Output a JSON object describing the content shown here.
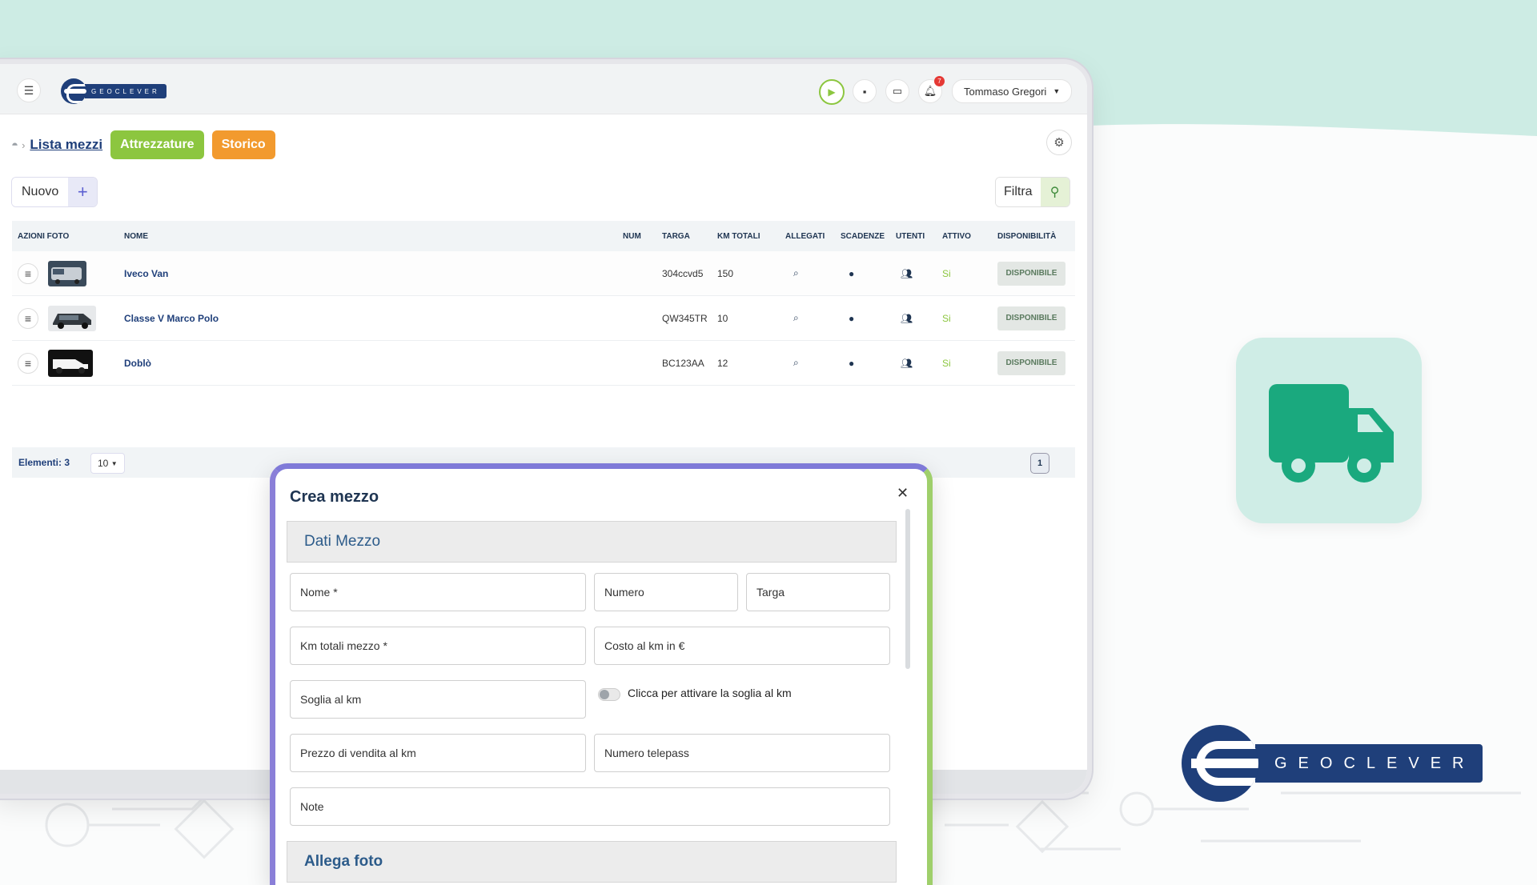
{
  "app": {
    "user_name": "Tommaso Gregori",
    "notification_count": "7",
    "brand": "GEOCLEVER"
  },
  "breadcrumb": {
    "title": "Lista mezzi",
    "tab_attrezzature": "Attrezzature",
    "tab_storico": "Storico"
  },
  "toolbar": {
    "nuovo_label": "Nuovo",
    "filtra_label": "Filtra"
  },
  "table": {
    "headers": [
      "AZIONI FOTO",
      "NOME",
      "NUM",
      "TARGA",
      "KM TOTALI",
      "ALLEGATI",
      "SCADENZE",
      "UTENTI",
      "ATTIVO",
      "DISPONIBILITÀ"
    ],
    "rows": [
      {
        "nome": "Iveco Van",
        "num": "",
        "targa": "304ccvd5",
        "km": "150",
        "attivo": "Si",
        "disponibilita": "DISPONIBILE"
      },
      {
        "nome": "Classe V Marco Polo",
        "num": "",
        "targa": "QW345TR",
        "km": "10",
        "attivo": "Si",
        "disponibilita": "DISPONIBILE"
      },
      {
        "nome": "Doblò",
        "num": "",
        "targa": "BC123AA",
        "km": "12",
        "attivo": "Si",
        "disponibilita": "DISPONIBILE"
      }
    ],
    "elements_label": "Elementi: 3",
    "page_size": "10",
    "current_page": "1"
  },
  "modal": {
    "title": "Crea mezzo",
    "section_dati": "Dati Mezzo",
    "section_foto": "Allega foto",
    "fields": {
      "nome": "Nome *",
      "numero": "Numero",
      "targa": "Targa",
      "km_totali": "Km totali mezzo *",
      "costo_km": "Costo al km in €",
      "soglia_km": "Soglia al km",
      "toggle_label": "Clicca per attivare la soglia al km",
      "prezzo_vendita": "Prezzo di vendita al km",
      "numero_telepass": "Numero telepass",
      "note": "Note"
    }
  },
  "colors": {
    "accent_green": "#8cc63f",
    "accent_orange": "#f29a2e",
    "brand_navy": "#1f3f7a",
    "truck_green": "#1aa97e",
    "mint_bg": "#cdece4"
  }
}
